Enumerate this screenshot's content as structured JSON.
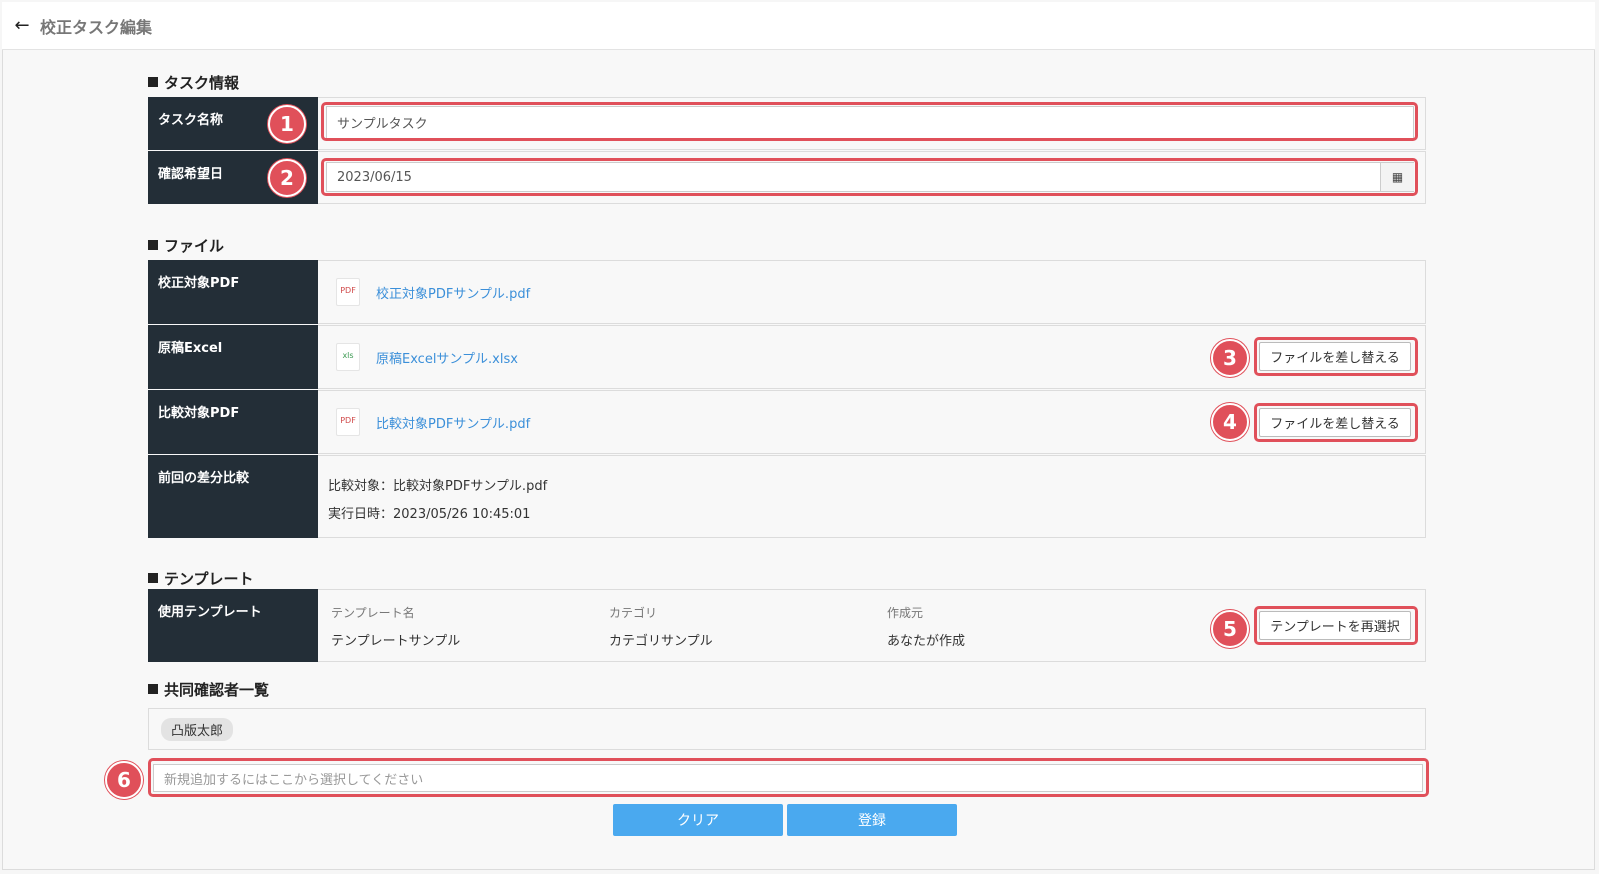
{
  "header": {
    "back_icon": "arrow-left-icon",
    "title": "校正タスク編集"
  },
  "sections": {
    "task_info": "タスク情報",
    "file": "ファイル",
    "template": "テンプレート",
    "reviewers": "共同確認者一覧"
  },
  "task": {
    "name_label": "タスク名称",
    "name_value": "サンプルタスク",
    "date_label": "確認希望日",
    "date_value": "2023/06/15",
    "calendar_icon": "calendar-icon"
  },
  "files": {
    "target_pdf_label": "校正対象PDF",
    "target_pdf_icon": "PDF",
    "target_pdf_name": "校正対象PDFサンプル.pdf",
    "excel_label": "原稿Excel",
    "excel_icon": "xls",
    "excel_name": "原稿Excelサンプル.xlsx",
    "compare_pdf_label": "比較対象PDF",
    "compare_pdf_icon": "PDF",
    "compare_pdf_name": "比較対象PDFサンプル.pdf",
    "replace_button": "ファイルを差し替える",
    "prev_diff_label": "前回の差分比較",
    "prev_diff_target": "比較対象：比較対象PDFサンプル.pdf",
    "prev_diff_date": "実行日時：2023/05/26 10:45:01"
  },
  "template": {
    "label": "使用テンプレート",
    "col_name_header": "テンプレート名",
    "col_name_value": "テンプレートサンプル",
    "col_category_header": "カテゴリ",
    "col_category_value": "カテゴリサンプル",
    "col_creator_header": "作成元",
    "col_creator_value": "あなたが作成",
    "reselect_button": "テンプレートを再選択"
  },
  "reviewers": {
    "chips": [
      "凸版太郎"
    ],
    "add_placeholder": "新規追加するにはここから選択してください"
  },
  "actions": {
    "clear": "クリア",
    "submit": "登録"
  },
  "annotations": [
    "1",
    "2",
    "3",
    "4",
    "5",
    "6"
  ],
  "colors": {
    "annotation": "#e0505a",
    "label_bg": "#232e37",
    "primary": "#4aa9ef",
    "link": "#3b8fd9"
  }
}
